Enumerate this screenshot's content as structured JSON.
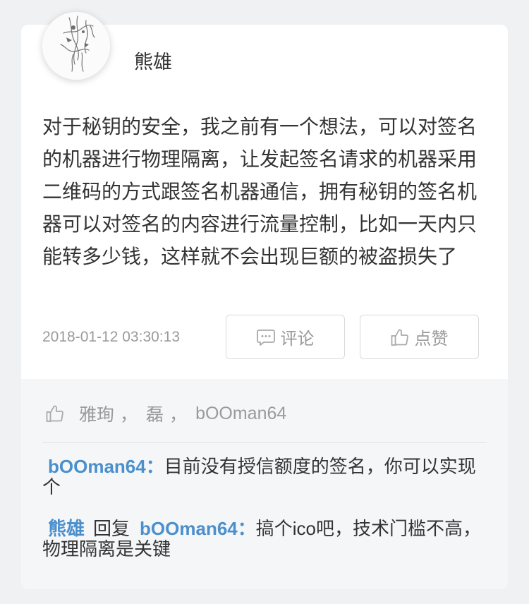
{
  "colors": {
    "page_background": "#eff1f3",
    "card_background": "#ffffff",
    "footer_background": "#f5f6f8",
    "text_primary": "#333333",
    "text_muted": "#9a9a9a",
    "link": "#4b8fcd",
    "border": "#dadada",
    "divider": "#e2e3e6"
  },
  "post": {
    "author": {
      "name": "熊雄"
    },
    "content": "对于秘钥的安全，我之前有一个想法，可以对签名的机器进行物理隔离，让发起签名请求的机器采用二维码的方式跟签名机器通信，拥有秘钥的签名机器可以对签名的内容进行流量控制，比如一天内只能转多少钱，这样就不会出现巨额的被盗损失了",
    "timestamp": "2018-01-12 03:30:13",
    "actions": {
      "comment": {
        "label": "评论",
        "icon": "comment-icon"
      },
      "like": {
        "label": "点赞",
        "icon": "thumbs-up-icon"
      }
    }
  },
  "likes": {
    "icon": "thumbs-up-icon",
    "separator": "，",
    "users": [
      "雅珣",
      "磊",
      "bOOman64"
    ]
  },
  "comment_colon": "：",
  "comments": [
    {
      "author": "bOOman64",
      "text": "目前没有授信额度的签名，你可以实现个"
    },
    {
      "author": "熊雄",
      "reply_label": "回复",
      "reply_to": "bOOman64",
      "text": "搞个ico吧，技术门槛不高，物理隔离是关键"
    }
  ]
}
